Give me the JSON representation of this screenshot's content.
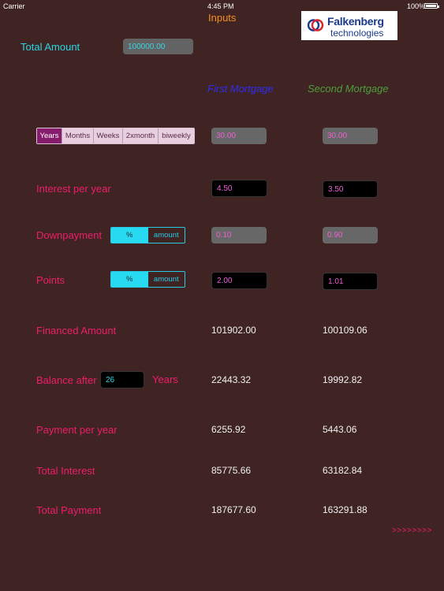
{
  "status_bar": {
    "carrier": "Carrier",
    "time": "4:45 PM",
    "battery": "100%"
  },
  "header": {
    "title": "Inputs",
    "logo_line1": "Falkenberg",
    "logo_line2": "technologies"
  },
  "total": {
    "label": "Total Amount",
    "value": "100000.00"
  },
  "columns": {
    "first": "First Mortgage",
    "second": "Second Mortgage"
  },
  "term_units": {
    "options": [
      "Years",
      "Months",
      "Weeks",
      "2xmonth",
      "biweekly"
    ],
    "selected": "Years"
  },
  "term": {
    "first": "30.00",
    "second": "30.00"
  },
  "interest": {
    "label": "Interest per year",
    "first": "4.50",
    "second": "3.50"
  },
  "downpayment": {
    "label": "Downpayment",
    "toggle": [
      "%",
      "amount"
    ],
    "selected": "%",
    "first": "0.10",
    "second": "0.90"
  },
  "points": {
    "label": "Points",
    "toggle": [
      "%",
      "amount"
    ],
    "selected": "%",
    "first": "2.00",
    "second": "1.01"
  },
  "financed": {
    "label": "Financed Amount",
    "first": "101902.00",
    "second": "100109.06"
  },
  "balance": {
    "label": "Balance after",
    "value": "26",
    "unit": "Years",
    "first": "22443.32",
    "second": "19992.82"
  },
  "payment": {
    "label": "Payment per year",
    "first": "6255.92",
    "second": "5443.06"
  },
  "total_interest": {
    "label": "Total Interest",
    "first": "85775.66",
    "second": "63182.84"
  },
  "total_payment": {
    "label": "Total Payment",
    "first": "187677.60",
    "second": "163291.88"
  },
  "next_link": ">>>>>>>>"
}
